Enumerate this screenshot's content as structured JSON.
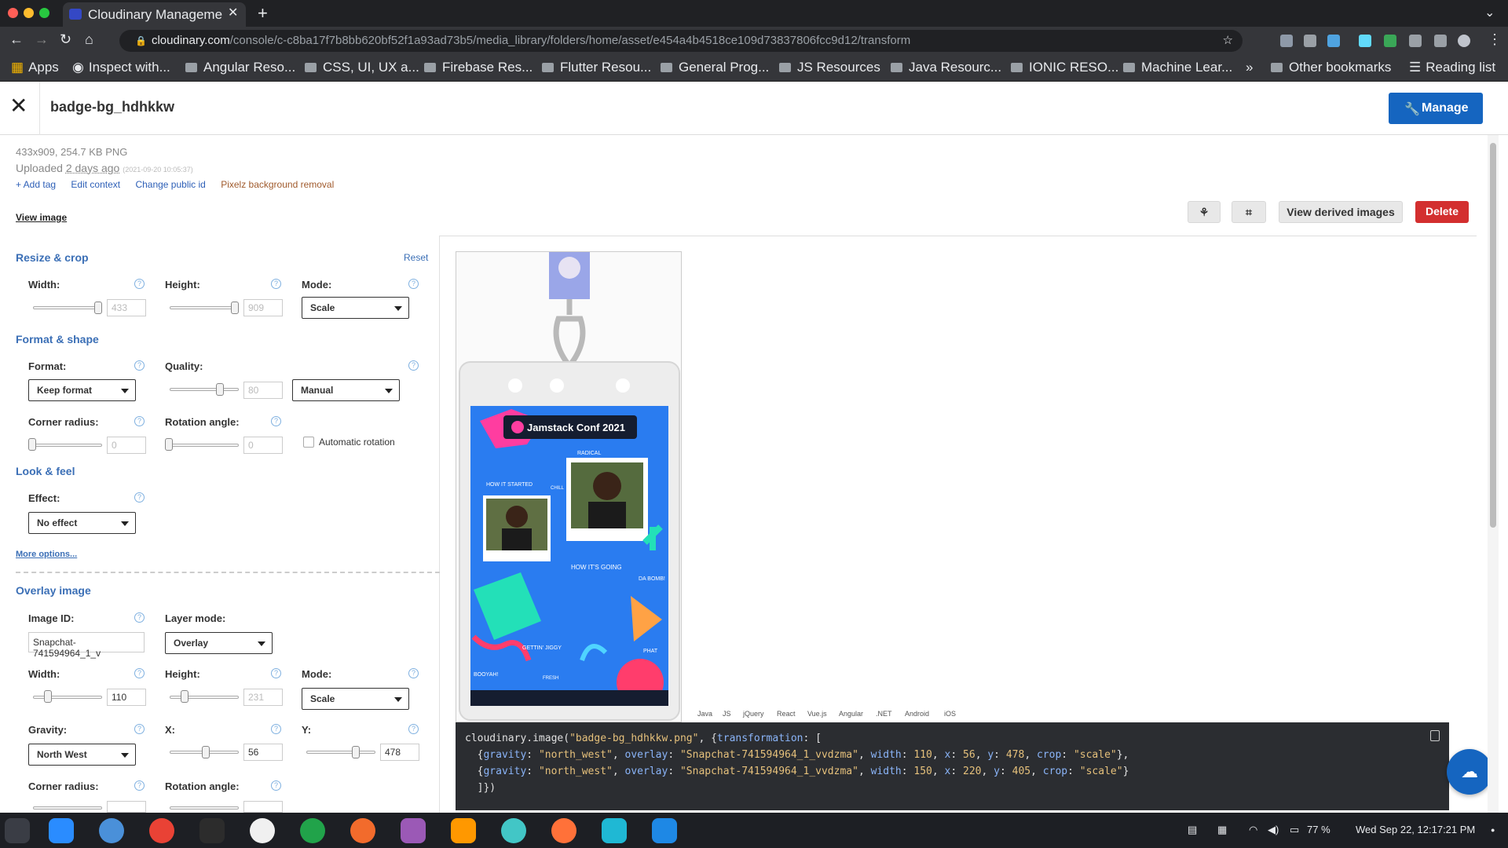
{
  "browser": {
    "tab_title": "Cloudinary Manageme",
    "url_host": "cloudinary.com",
    "url_path": "/console/c-c8ba17f7b8bb620bf52f1a93ad73b5/media_library/folders/home/asset/e454a4b4518ce109d73837806fcc9d12/transform",
    "bookmarks": [
      "Apps",
      "Inspect with...",
      "Angular Reso...",
      "CSS, UI, UX a...",
      "Firebase Res...",
      "Flutter Resou...",
      "General Prog...",
      "JS Resources",
      "Java Resourc...",
      "IONIC RESO...",
      "Machine Lear..."
    ],
    "more_bookmarks": "»",
    "other_bookmarks": "Other bookmarks",
    "reading_list": "Reading list"
  },
  "header": {
    "asset_name": "badge-bg_hdhkkw",
    "manage_label": "Manage"
  },
  "meta": {
    "dimensions": "433x909, 254.7 KB PNG",
    "uploaded_prefix": "Uploaded",
    "uploaded_rel": "2 days ago",
    "uploaded_date": "(2021-09-20 10:05:37)",
    "links": [
      "+ Add tag",
      "Edit context",
      "Change public id",
      "Pixelz background removal"
    ],
    "view_image": "View image"
  },
  "toolbar": {
    "view_derived": "View derived images",
    "delete": "Delete"
  },
  "resize": {
    "title": "Resize & crop",
    "reset": "Reset",
    "width_label": "Width:",
    "width_value": "433",
    "height_label": "Height:",
    "height_value": "909",
    "mode_label": "Mode:",
    "mode_value": "Scale"
  },
  "format": {
    "title": "Format & shape",
    "format_label": "Format:",
    "format_value": "Keep format",
    "quality_label": "Quality:",
    "quality_value": "80",
    "quality_mode": "Manual",
    "corner_label": "Corner radius:",
    "corner_value": "0",
    "rotation_label": "Rotation angle:",
    "rotation_value": "0",
    "auto_rotation": "Automatic rotation"
  },
  "look": {
    "title": "Look & feel",
    "effect_label": "Effect:",
    "effect_value": "No effect",
    "more_options": "More options..."
  },
  "overlay": {
    "title": "Overlay image",
    "image_id_label": "Image ID:",
    "image_id_value": "Snapchat-741594964_1_v",
    "layer_mode_label": "Layer mode:",
    "layer_mode_value": "Overlay",
    "width_label": "Width:",
    "width_value": "110",
    "height_label": "Height:",
    "height_value": "231",
    "mode_label": "Mode:",
    "mode_value": "Scale",
    "gravity_label": "Gravity:",
    "gravity_value": "North West",
    "x_label": "X:",
    "x_value": "56",
    "y_label": "Y:",
    "y_value": "478",
    "corner_label": "Corner radius:",
    "rotation_label": "Rotation angle:"
  },
  "preview": {
    "banner": "Jamstack Conf 2021",
    "words": [
      "RADICAL",
      "HOW IT STARTED",
      "HOW IT'S GOING",
      "DA BOMB!",
      "GETTIN' JIGGY",
      "PHAT",
      "BOOYAH!",
      "FRESH",
      "CHILL"
    ]
  },
  "code": {
    "languages": [
      "Java",
      "JS",
      "jQuery",
      "React",
      "Vue.js",
      "Angular",
      ".NET",
      "Android",
      "iOS"
    ],
    "line1_a": "cloudinary.image(",
    "line1_str": "\"badge-bg_hdhkkw.png\"",
    "line1_b": ", {",
    "line1_key": "transformation",
    "line1_c": ": [",
    "row1": {
      "gravity": "\"north_west\"",
      "overlay": "\"Snapchat-741594964_1_vvdzma\"",
      "width": "110",
      "x": "56",
      "y": "478",
      "crop": "\"scale\""
    },
    "row2": {
      "gravity": "\"north_west\"",
      "overlay": "\"Snapchat-741594964_1_vvdzma\"",
      "width": "150",
      "x": "220",
      "y": "405",
      "crop": "\"scale\""
    },
    "close": "]})"
  },
  "taskbar": {
    "battery": "77 %",
    "clock": "Wed Sep 22, 12:17:21 PM"
  }
}
